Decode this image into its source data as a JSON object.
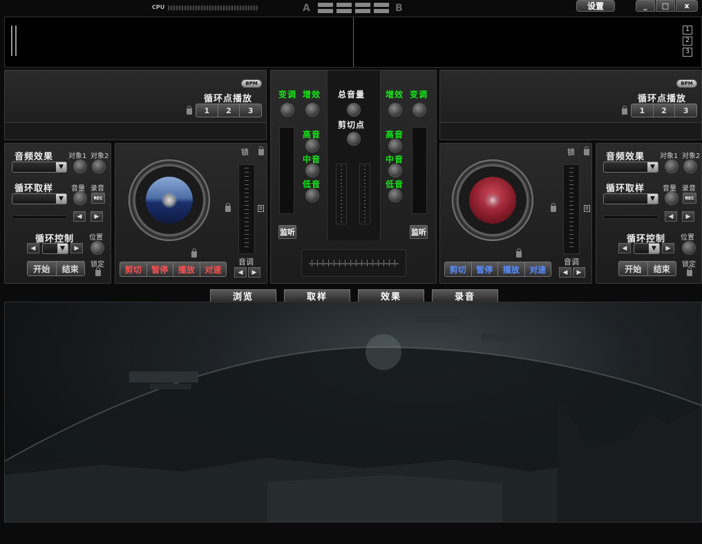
{
  "topbar": {
    "cpu_label": "CPU",
    "a_label": "A",
    "b_label": "B",
    "settings": "设置",
    "minimize": "_",
    "maximize": "□",
    "close": "x"
  },
  "display": {
    "pages": [
      "1",
      "2",
      "3"
    ]
  },
  "loop_point": {
    "bpm": "BPM",
    "title": "循环点播放",
    "buttons": [
      "1",
      "2",
      "3"
    ]
  },
  "deck": {
    "audio_effect": "音频效果",
    "target1": "对象1",
    "target2": "对象2",
    "loop_sample": "循环取样",
    "volume": "音量",
    "record": "录音",
    "rec": "REC",
    "loop_control": "循环控制",
    "position": "位置",
    "start": "开始",
    "end": "结束",
    "lock": "锁定",
    "lock_short": "锁",
    "pitch": "音调",
    "zero": "0",
    "transport": [
      "剪切",
      "暂停",
      "播放",
      "对速"
    ]
  },
  "mixer": {
    "pitch": "变调",
    "gain": "增效",
    "master_volume": "总音量",
    "cut_point": "剪切点",
    "high": "高音",
    "mid": "中音",
    "low": "低音",
    "monitor": "监听"
  },
  "tabs": [
    "浏览",
    "取样",
    "效果",
    "录音"
  ],
  "colors": {
    "accent_green": "#15e815",
    "transport_left": "#ff5050",
    "transport_right": "#5a8cff"
  }
}
